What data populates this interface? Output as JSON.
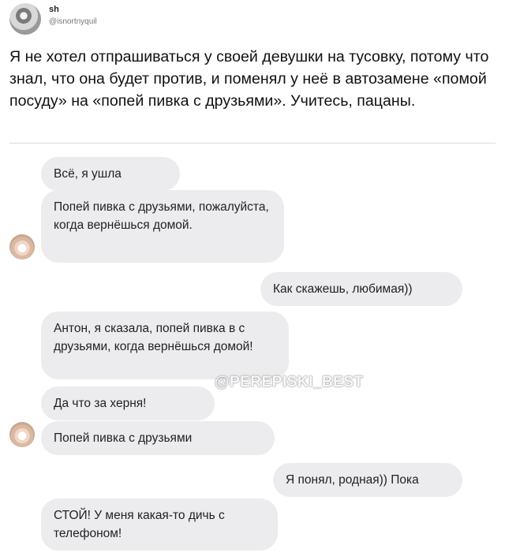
{
  "tweet": {
    "username": "sh",
    "handle": "@isnortnyquil",
    "text": "Я не хотел отпрашиваться у своей девушки на тусовку, потому что знал, что она будет против, и поменял у неё в автозамене «помой посуду» на «попей пивка с друзьями». Учитесь, пацаны."
  },
  "chat": {
    "messages": [
      {
        "side": "incoming",
        "text": "Всё, я ушла"
      },
      {
        "side": "incoming",
        "text": "Попей пивка с друзьями, пожалуйста, когда вернёшься домой."
      },
      {
        "side": "outgoing",
        "text": "Как скажешь, любимая))"
      },
      {
        "side": "incoming",
        "text": "Антон, я сказала, попей пивка в с друзьями, когда вернёшься домой!"
      },
      {
        "side": "incoming",
        "text": "Да что за херня!"
      },
      {
        "side": "incoming",
        "text": "Попей пивка с друзьями"
      },
      {
        "side": "outgoing",
        "text": "Я понял, родная)) Пока"
      },
      {
        "side": "incoming",
        "text": "СТОЙ! У меня какая-то дичь с телефоном!"
      }
    ]
  },
  "watermark": "@PEREPISKI_BEST"
}
